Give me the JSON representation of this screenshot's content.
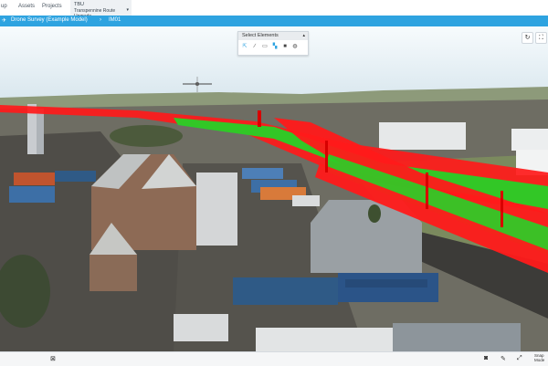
{
  "nav": {
    "items": [
      "up",
      "Assets",
      "Projects"
    ],
    "tab": {
      "line1": "TBU",
      "line2": "Transpennine Route Upgrade",
      "caret": "▾"
    }
  },
  "breadcrumb": {
    "home_icon": "drone-icon",
    "project": "Drone Survey (Example Model)",
    "separator": "›",
    "current": "IM01"
  },
  "select_elements": {
    "title": "Select Elements",
    "caret": "▴",
    "tools": [
      "select-pointer-icon",
      "line-icon",
      "rectangle-icon",
      "layers-icon",
      "cube-icon",
      "globe-icon"
    ]
  },
  "view_controls": {
    "reset": "reset-view-icon",
    "fullscreen": "fullscreen-icon"
  },
  "bottom_bar": {
    "left_icon": "fit-view-icon",
    "right_icons": [
      "camera-icon",
      "edit-icon",
      "fullscreen-icon"
    ],
    "snap_line1": "Snap",
    "snap_line2": "Mode"
  },
  "colors": {
    "accent": "#2ea3e0",
    "model_red": "#ff1a1a",
    "model_green": "#27d127"
  }
}
